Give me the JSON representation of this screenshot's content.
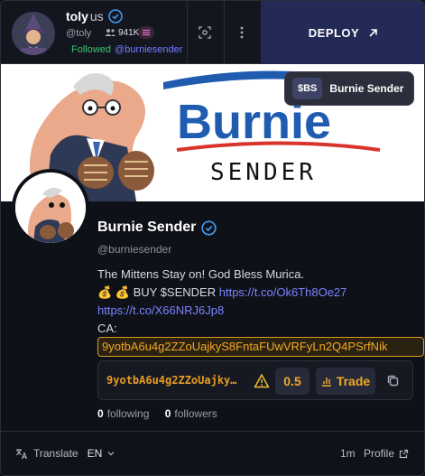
{
  "header": {
    "name": "toly",
    "name_suffix": "us",
    "handle": "@toly",
    "follower_count": "941K",
    "followed_label": "Followed",
    "followed_handle": "@burniesender",
    "deploy_label": "DEPLOY"
  },
  "banner": {
    "title_top": "Burnie",
    "title_bottom": "SENDER"
  },
  "token": {
    "ticker": "$BS",
    "name": "Burnie Sender"
  },
  "profile": {
    "name": "Burnie Sender",
    "handle": "@burniesender",
    "bio_line1": "The Mittens Stay on! God Bless Murica.",
    "bio_line2_text": "💰 💰  BUY $SENDER",
    "bio_link1": "https://t.co/Ok6Th8Oe27",
    "bio_link2": "https://t.co/X66NRJ6Jp8",
    "ca_label": "CA:",
    "ca_address": "9yotbA6u4g2ZZoUajkyS8FntaFUwVRFyLn2Q4PSrfNik"
  },
  "trade": {
    "address_short": "9yotbA6u4g2ZZoUajky…",
    "amount": "0.5",
    "trade_label": "Trade"
  },
  "stats": {
    "following_count": "0",
    "following_label": "following",
    "followers_count": "0",
    "followers_label": "followers"
  },
  "footer": {
    "translate_label": "Translate",
    "language": "EN",
    "time": "1m",
    "profile_label": "Profile"
  },
  "colors": {
    "accent_orange": "#f2a828",
    "link_blue": "#7b83ff",
    "verified_blue": "#3b9cf0",
    "followed_green": "#3ec46d",
    "deploy_bg": "#232a56"
  }
}
